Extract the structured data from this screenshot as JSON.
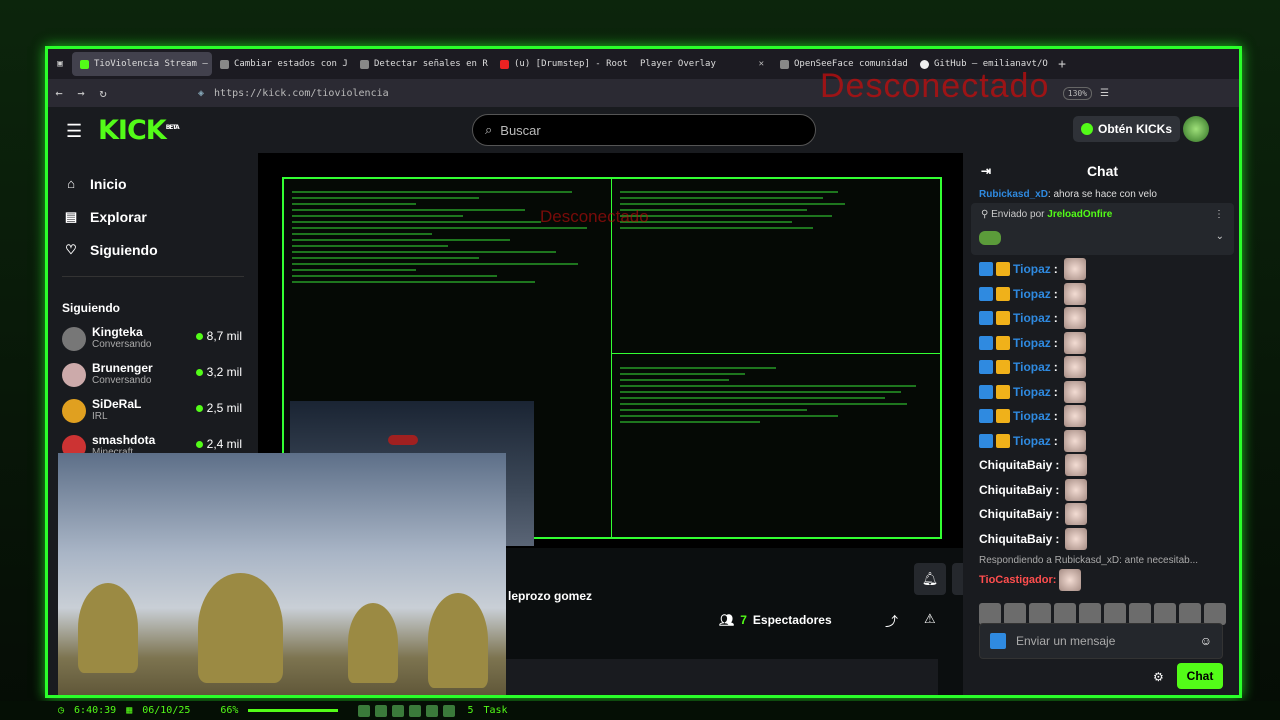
{
  "browser": {
    "tabs": [
      {
        "label": "TioViolencia Stream –",
        "active": true
      },
      {
        "label": "Cambiar estados con J",
        "active": false
      },
      {
        "label": "Detectar señales en R",
        "active": false
      },
      {
        "label": "(u) [Drumstep] - Root",
        "active": false
      },
      {
        "label": "Player Overlay",
        "active": false
      },
      {
        "label": "OpenSeeFace comunidad",
        "active": false
      },
      {
        "label": "GitHub – emilianavt/O",
        "active": false
      }
    ],
    "url": "https://kick.com/tioviolencia",
    "zoom": "130%",
    "overlay_text": "Desconectado"
  },
  "header": {
    "logo": "KICK",
    "logo_badge": "BETA",
    "search_placeholder": "Buscar",
    "kicks_label": "Obtén KICKs"
  },
  "sidebar": {
    "nav": [
      {
        "label": "Inicio",
        "icon": "home-icon"
      },
      {
        "label": "Explorar",
        "icon": "browse-icon"
      },
      {
        "label": "Siguiendo",
        "icon": "heart-icon"
      }
    ],
    "following_title": "Siguiendo",
    "channels": [
      {
        "name": "Kingteka",
        "category": "Conversando",
        "viewers": "8,7 mil",
        "color": "#777"
      },
      {
        "name": "Brunenger",
        "category": "Conversando",
        "viewers": "3,2 mil",
        "color": "#caa"
      },
      {
        "name": "SiDeRaL",
        "category": "IRL",
        "viewers": "2,5 mil",
        "color": "#e0a020"
      },
      {
        "name": "smashdota",
        "category": "Minecraft",
        "viewers": "2,4 mil",
        "color": "#c33"
      }
    ]
  },
  "stream": {
    "term_overlay": "Desconectado",
    "streamer": "leprozo gomez",
    "viewers_count": "7",
    "viewers_label": "Espectadores"
  },
  "chat": {
    "title": "Chat",
    "pinned_preview_user": "Rubickasd_xD",
    "pinned_preview_text": "ahora se hace con velo",
    "pinned_by_label": "Enviado por",
    "pinned_by_user": "JreloadOnfire",
    "messages": [
      {
        "user": "Tiopaz",
        "badges": true
      },
      {
        "user": "Tiopaz",
        "badges": true
      },
      {
        "user": "Tiopaz",
        "badges": true
      },
      {
        "user": "Tiopaz",
        "badges": true
      },
      {
        "user": "Tiopaz",
        "badges": true
      },
      {
        "user": "Tiopaz",
        "badges": true
      },
      {
        "user": "Tiopaz",
        "badges": true
      },
      {
        "user": "Tiopaz",
        "badges": true
      },
      {
        "user": "ChiquitaBaiy",
        "badges": false
      },
      {
        "user": "ChiquitaBaiy",
        "badges": false
      },
      {
        "user": "ChiquitaBaiy",
        "badges": false
      },
      {
        "user": "ChiquitaBaiy",
        "badges": false
      }
    ],
    "reply_label": "Respondiendo a Rubickasd_xD: ante necesitab...",
    "reply_user": "TioCastigador",
    "input_placeholder": "Enviar un mensaje",
    "send_label": "Chat"
  },
  "taskbar": {
    "time": "6:40:39",
    "date": "06/10/25",
    "volume": "66%",
    "workspace": "5",
    "task_label": "Task"
  }
}
